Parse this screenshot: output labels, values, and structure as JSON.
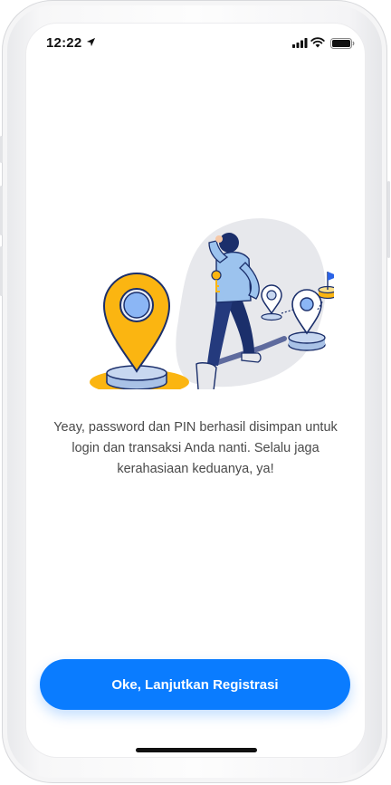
{
  "status_bar": {
    "time": "12:22",
    "icons": [
      "location-arrow-icon",
      "cellular-signal-icon",
      "wifi-icon",
      "battery-icon"
    ]
  },
  "illustration": {
    "description_icon": "person-walking-map-pins-illustration",
    "colors": {
      "pin_yellow": "#fbb511",
      "pin_blue": "#8bb6f5",
      "navy": "#1b2f6b",
      "shirt_blue": "#9cc3ee",
      "flag_blue": "#2b63e6",
      "blob_gray": "#e7e8ec"
    }
  },
  "message": {
    "text": "Yeay, password dan PIN berhasil disimpan untuk login dan transaksi Anda nanti. Selalu jaga kerahasiaan keduanya, ya!"
  },
  "cta": {
    "label": "Oke, Lanjutkan Registrasi",
    "color": "#0a7cff"
  }
}
